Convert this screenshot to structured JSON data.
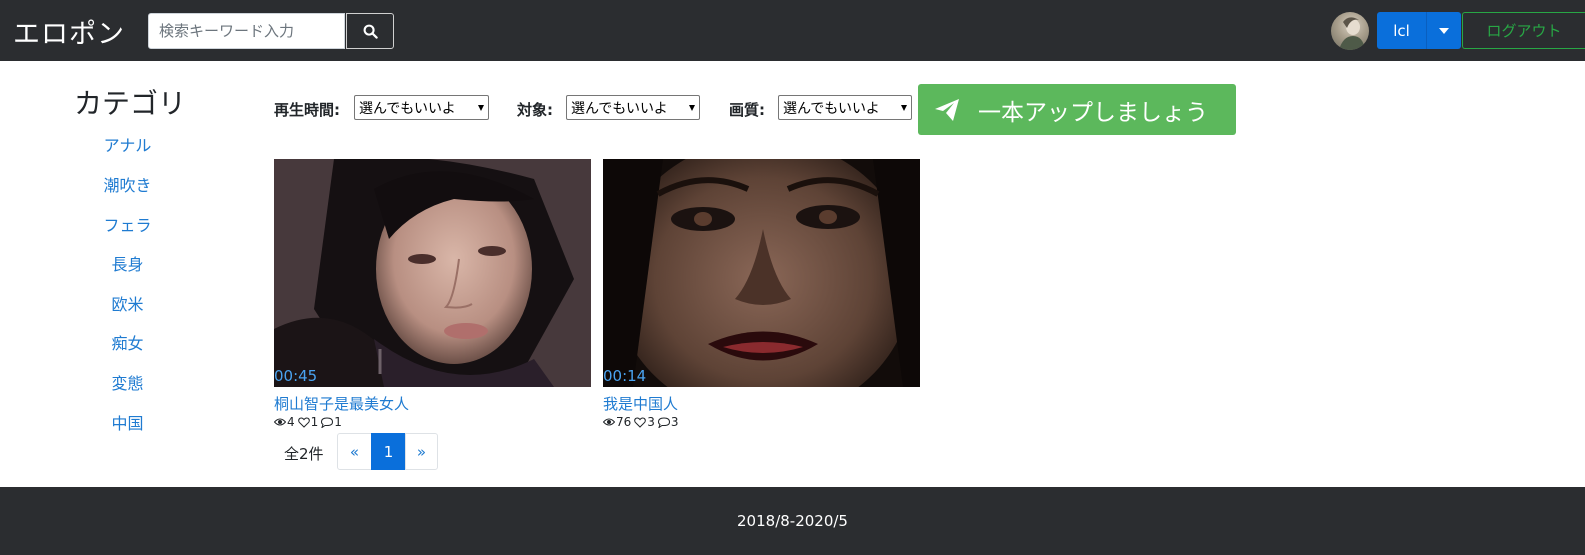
{
  "navbar": {
    "brand": "エロポン",
    "search_placeholder": "検索キーワード入力",
    "username": "lcl",
    "logout_label": "ログアウト"
  },
  "sidebar": {
    "title": "カテゴリ",
    "items": [
      "アナル",
      "潮吹き",
      "フェラ",
      "長身",
      "欧米",
      "痴女",
      "変態",
      "中国"
    ]
  },
  "filters": {
    "duration_label": "再生時間:",
    "duration_value": "選んでもいいよ",
    "target_label": "対象:",
    "target_value": "選んでもいいよ",
    "quality_label": "画質:",
    "quality_value": "選んでもいいよ"
  },
  "upload_label": "一本アップしましょう",
  "videos": [
    {
      "title": "桐山智子是最美女人",
      "duration": "00:45",
      "views": "4",
      "likes": "1",
      "comments": "1"
    },
    {
      "title": "我是中国人",
      "duration": "00:14",
      "views": "76",
      "likes": "3",
      "comments": "3"
    }
  ],
  "pagination": {
    "total": "全2件",
    "prev": "«",
    "current": "1",
    "next": "»"
  },
  "footer": {
    "text": "2018/8-2020/5"
  },
  "colors": {
    "navbar_bg": "#2b2d30",
    "primary": "#0a6fdb",
    "success": "#5cb85c",
    "link": "#1f7bd1",
    "outline_success": "#28a745"
  },
  "icons": [
    "search-icon",
    "chevron-down-icon",
    "paper-plane-icon",
    "eye-icon",
    "heart-icon",
    "comment-icon"
  ]
}
